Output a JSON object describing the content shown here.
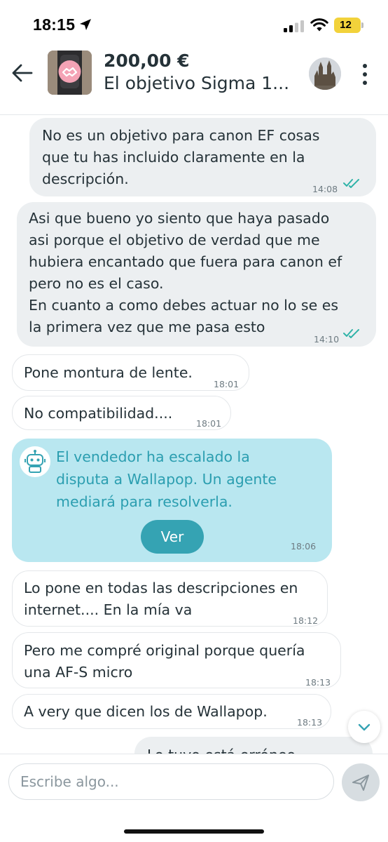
{
  "status_bar": {
    "time": "18:15",
    "battery": "12",
    "icons": [
      "location-arrow-icon",
      "cellular-signal-icon",
      "wifi-icon",
      "battery-icon"
    ],
    "battery_color": "#f2d23b"
  },
  "header": {
    "price": "200,00 €",
    "title": "El objetivo Sigma 1...",
    "icons": [
      "back-arrow-icon",
      "more-vertical-icon"
    ]
  },
  "messages": [
    {
      "id": "m1",
      "direction": "out",
      "text": "No es un objetivo para canon EF cosas\nque tu has incluido claramente en la\ndescripción.",
      "time": "14:08",
      "read": true
    },
    {
      "id": "m2",
      "direction": "out",
      "text": "Asi que bueno yo siento que haya pasado\nasi porque el objetivo de verdad que me\nhubiera encantado que fuera para canon ef\npero no es el caso.\nEn cuanto a como debes actuar no lo se es\nla primera vez que me pasa esto",
      "time": "14:10",
      "read": true
    },
    {
      "id": "m3",
      "direction": "in",
      "text": "Pone montura de lente.",
      "time": "18:01"
    },
    {
      "id": "m4",
      "direction": "in",
      "text": "No compatibilidad....",
      "time": "18:01"
    },
    {
      "id": "m6",
      "direction": "in",
      "text": "Lo pone en todas las descripciones en\ninternet.... En la mía va",
      "time": "18:12"
    },
    {
      "id": "m7",
      "direction": "in",
      "text": "Pero me compré original porque quería\nuna AF-S micro",
      "time": "18:13"
    },
    {
      "id": "m8",
      "direction": "in",
      "text": "A very que dicen los de Wallapop.",
      "time": "18:13"
    }
  ],
  "system_message": {
    "text": "El vendedor ha escalado la\ndisputa a Wallapop. Un agente\nmediará para resolverla.",
    "button_label": "Ver",
    "time": "18:06",
    "icon": "robot-icon",
    "background": "#b9e7f0",
    "accent": "#35a3b3"
  },
  "partial_message": {
    "text": "Lo tuyo está erróneo"
  },
  "composer": {
    "placeholder": "Escribe algo...",
    "send_icon": "send-icon",
    "scroll_icon": "chevron-down-icon"
  },
  "colors": {
    "read_ticks": "#2fb3a8",
    "outgoing_bubble": "#eceff1",
    "text": "#253238"
  }
}
